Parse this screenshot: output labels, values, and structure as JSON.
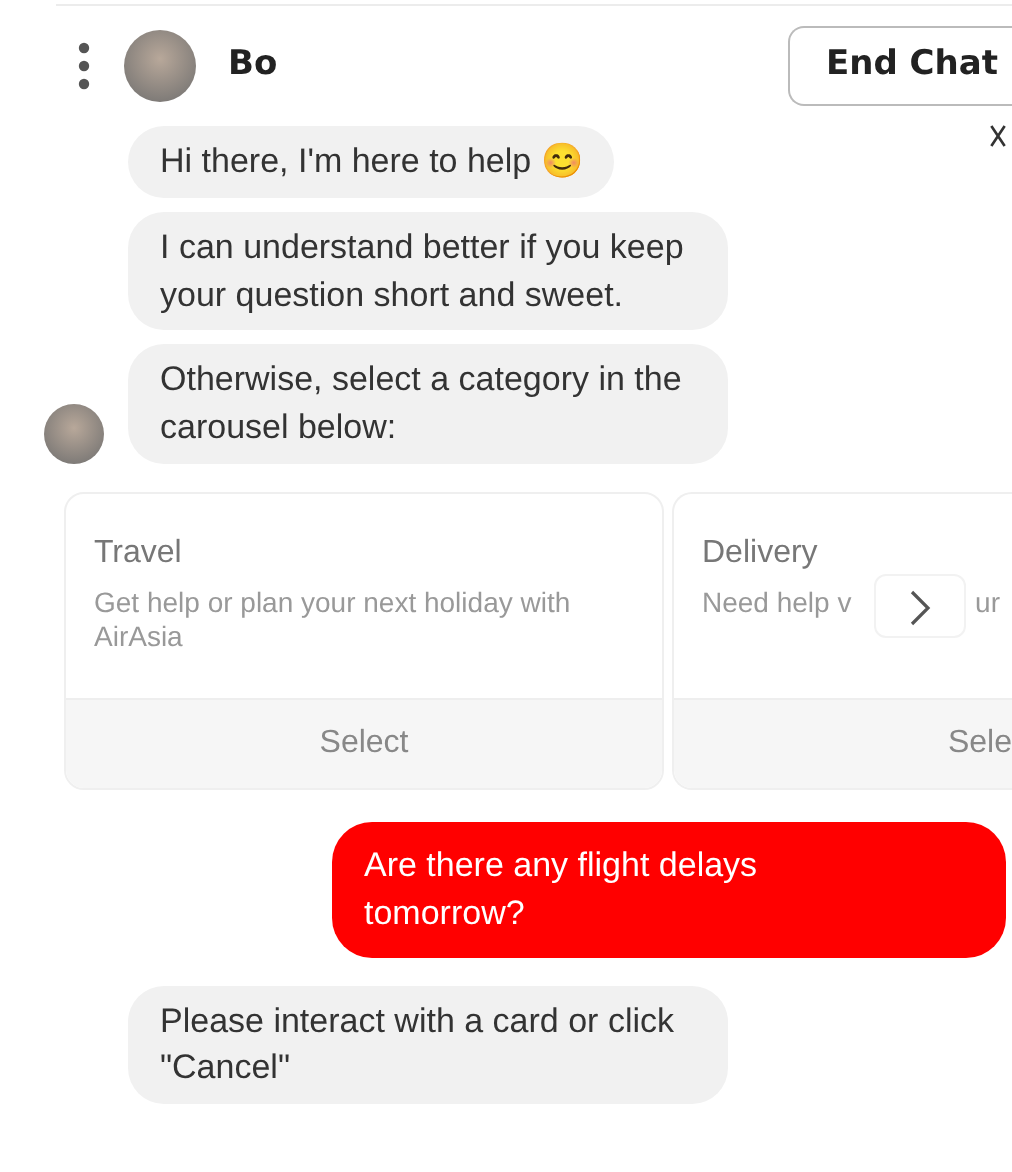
{
  "header": {
    "agent_name": "Bo",
    "end_button": "End Chat"
  },
  "messages": [
    {
      "kind": "bot",
      "text": "Hi there, I'm here to help 😊",
      "avatar": false
    },
    {
      "kind": "bot",
      "text": "I can understand better if you keep your question short and sweet.",
      "avatar": false
    },
    {
      "kind": "bot",
      "text": "Otherwise, select a category in the carousel below:",
      "avatar": true
    },
    {
      "kind": "carousel",
      "cards": [
        {
          "title": "Travel",
          "description": [
            "Get help or plan your next holiday with AirAsia"
          ],
          "button": "Select"
        },
        {
          "title": "Delivery",
          "description": [
            "Need help v",
            "ur"
          ],
          "button": "Sele"
        }
      ]
    },
    {
      "kind": "user",
      "text": "Are there any flight delays tomorrow?",
      "color": "#ff0000"
    },
    {
      "kind": "bot",
      "text": "Please interact with a card or click \"Cancel\"",
      "avatar": false
    }
  ]
}
